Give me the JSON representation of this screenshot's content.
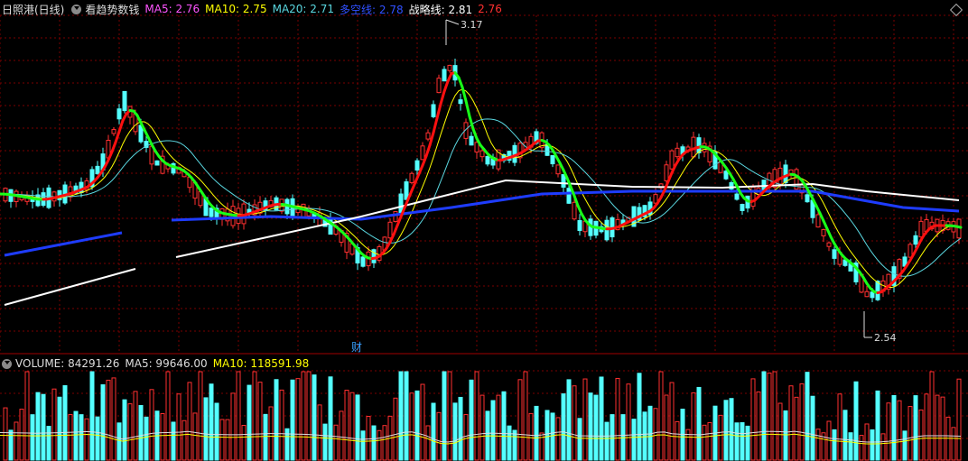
{
  "header": {
    "stock": "日照港(日线)",
    "indicator": "看趋势数钱",
    "ma5": "MA5: 2.76",
    "ma10": "MA10: 2.75",
    "ma20": "MA20: 2.71",
    "duokong": "多空线: 2.78",
    "zhanlue_label": "战略线: 2.81",
    "zhanlue_value": "2.76"
  },
  "volume_header": {
    "volume": "VOLUME: 84291.26",
    "ma5": "MA5: 99646.00",
    "ma10": "MA10: 118591.98"
  },
  "annotations": {
    "high": "3.17",
    "low": "2.54",
    "cai": "财"
  },
  "colors": {
    "up": "#ff3030",
    "down": "#54ffff",
    "ma5": "#ffffff",
    "ma10": "#ffff00",
    "ma20": "#5ad7e0",
    "duokong": "#1e3cff",
    "zhanlue": "#ffffff",
    "trend_up": "#ff1010",
    "trend_down": "#18ff18",
    "grid": "#7a0000"
  },
  "icons": [
    "dropdown-icon",
    "diamond-icon"
  ]
}
